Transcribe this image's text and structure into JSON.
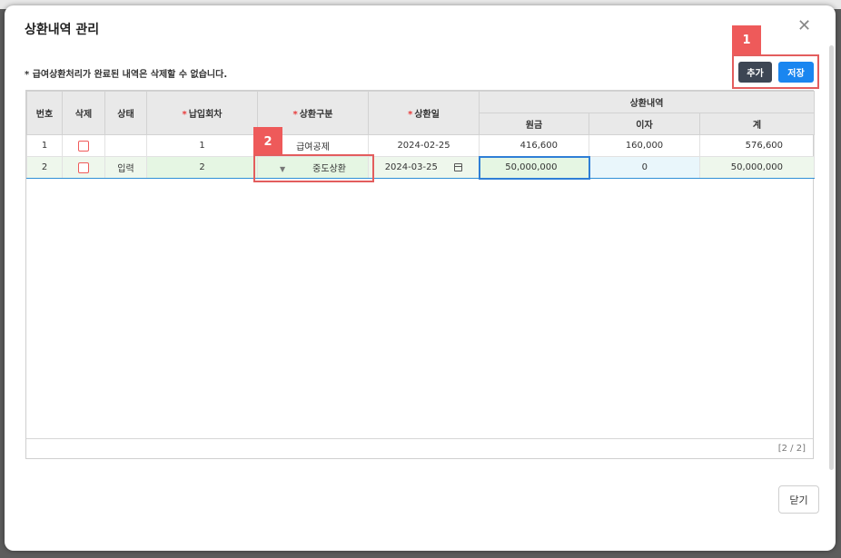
{
  "dialog": {
    "title": "상환내역 관리",
    "notice": "* 급여상환처리가 완료된 내역은 삭제할 수 없습니다.",
    "add_label": "추가",
    "save_label": "저장",
    "close_label": "닫기",
    "page_indicator": "[2 / 2]"
  },
  "annotations": {
    "badge1": "1",
    "badge2": "2"
  },
  "table": {
    "headers": {
      "no": "번호",
      "delete": "삭제",
      "status": "상태",
      "pay_round": "납입회차",
      "repay_type": "상환구분",
      "repay_date": "상환일",
      "group": "상환내역",
      "principal": "원금",
      "interest": "이자",
      "total": "계"
    },
    "rows": [
      {
        "no": "1",
        "status": "",
        "pay_round": "1",
        "repay_type": "급여공제",
        "repay_date": "2024-02-25",
        "principal": "416,600",
        "interest": "160,000",
        "total": "576,600"
      },
      {
        "no": "2",
        "status": "입력",
        "pay_round": "2",
        "repay_type": "중도상환",
        "repay_date": "2024-03-25",
        "principal": "50,000,000",
        "interest": "0",
        "total": "50,000,000"
      }
    ]
  },
  "colors": {
    "accent": "#1a86f0",
    "annotation": "#ee5a5a",
    "dark_button": "#3d4654"
  }
}
